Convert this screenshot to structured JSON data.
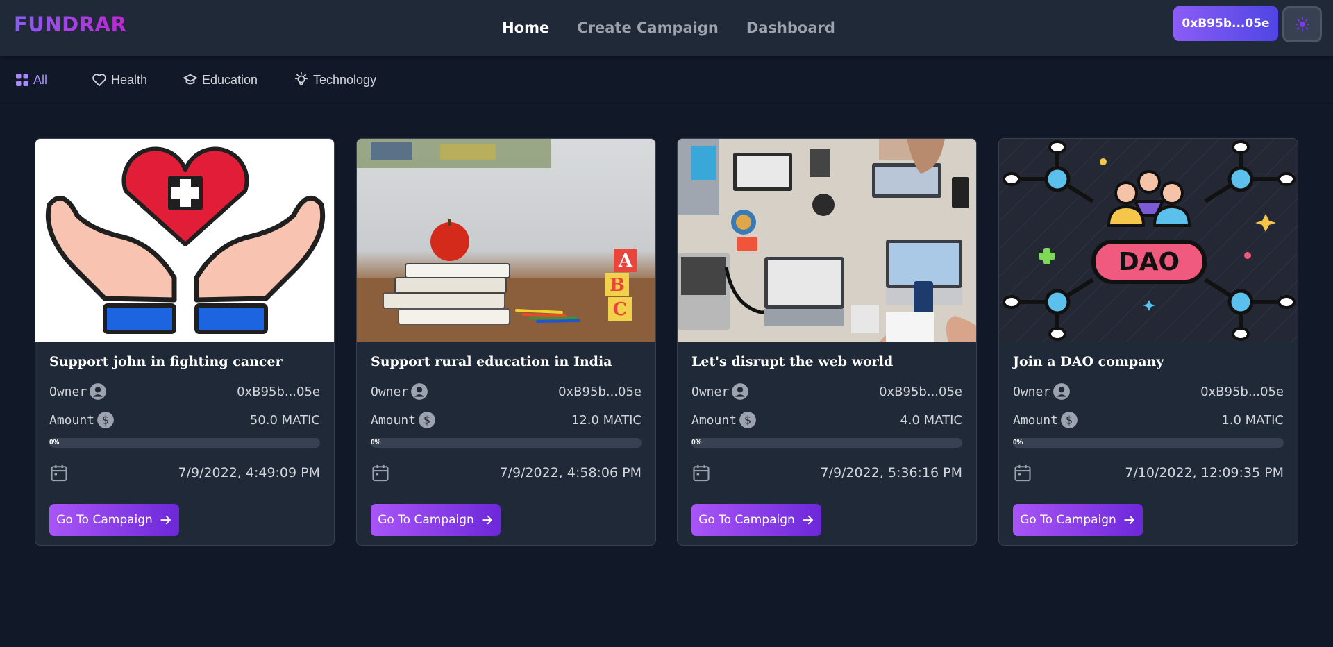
{
  "header": {
    "logo": "FUNDRAR",
    "nav": [
      {
        "label": "Home",
        "active": true
      },
      {
        "label": "Create Campaign",
        "active": false
      },
      {
        "label": "Dashboard",
        "active": false
      }
    ],
    "wallet": "0xB95b...05e",
    "theme_icon": "sun-icon"
  },
  "categories": [
    {
      "label": "All",
      "icon": "grid-icon",
      "active": true
    },
    {
      "label": "Health",
      "icon": "heart-icon",
      "active": false
    },
    {
      "label": "Education",
      "icon": "graduation-cap-icon",
      "active": false
    },
    {
      "label": "Technology",
      "icon": "lightbulb-icon",
      "active": false
    }
  ],
  "labels": {
    "owner": "Owner",
    "amount": "Amount",
    "button": "Go To Campaign"
  },
  "campaigns": [
    {
      "title": "Support john in fighting cancer",
      "owner": "0xB95b...05e",
      "amount": "50.0 MATIC",
      "progress_label": "0%",
      "progress": 0,
      "date": "7/9/2022, 4:49:09 PM",
      "image": "hands-heart-medical-illustration"
    },
    {
      "title": "Support rural education in India",
      "owner": "0xB95b...05e",
      "amount": "12.0 MATIC",
      "progress_label": "0%",
      "progress": 0,
      "date": "7/9/2022, 4:58:06 PM",
      "image": "books-apple-abc-blocks-photo"
    },
    {
      "title": "Let's disrupt the web world",
      "owner": "0xB95b...05e",
      "amount": "4.0 MATIC",
      "progress_label": "0%",
      "progress": 0,
      "date": "7/9/2022, 5:36:16 PM",
      "image": "laptops-on-desk-photo"
    },
    {
      "title": "Join a DAO company",
      "owner": "0xB95b...05e",
      "amount": "1.0 MATIC",
      "progress_label": "0%",
      "progress": 0,
      "date": "7/10/2022, 12:09:35 PM",
      "image": "dao-network-illustration",
      "image_text": "DAO"
    }
  ],
  "colors": {
    "background": "#111827",
    "header": "#1f2937",
    "card": "#1f2937",
    "accent": "#8b5cf6"
  }
}
